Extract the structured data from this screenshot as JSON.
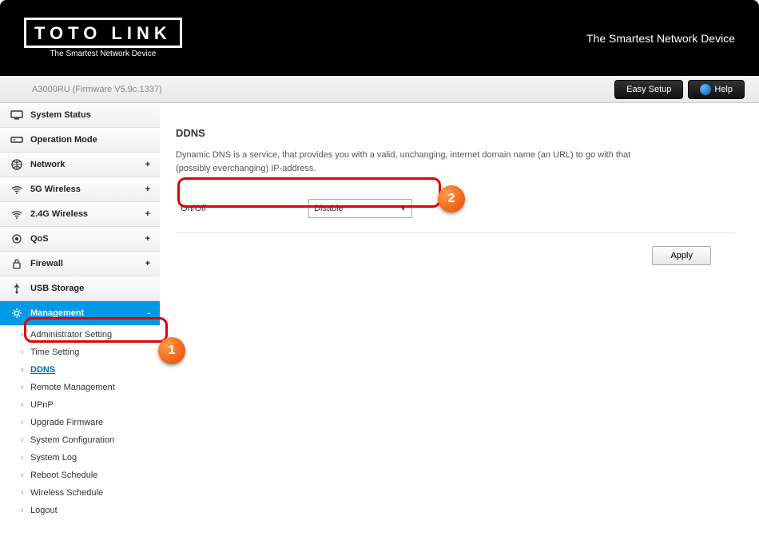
{
  "header": {
    "logo_top": "TOTO LINK",
    "logo_bottom": "The Smartest Network Device",
    "tagline": "The Smartest Network Device"
  },
  "topbar": {
    "device_info": "A3000RU (Firmware V5.9c.1337)",
    "easy_setup": "Easy Setup",
    "help": "Help"
  },
  "sidebar": {
    "items": [
      {
        "label": "System Status",
        "expandable": false
      },
      {
        "label": "Operation Mode",
        "expandable": false
      },
      {
        "label": "Network",
        "expandable": true
      },
      {
        "label": "5G Wireless",
        "expandable": true
      },
      {
        "label": "2.4G Wireless",
        "expandable": true
      },
      {
        "label": "QoS",
        "expandable": true
      },
      {
        "label": "Firewall",
        "expandable": true
      },
      {
        "label": "USB Storage",
        "expandable": false
      },
      {
        "label": "Management",
        "expandable": true,
        "active": true,
        "expand_char": "-"
      }
    ],
    "management_sub": [
      {
        "label": "Administrator Setting"
      },
      {
        "label": "Time Setting"
      },
      {
        "label": "DDNS",
        "selected": true
      },
      {
        "label": "Remote Management"
      },
      {
        "label": "UPnP"
      },
      {
        "label": "Upgrade Firmware"
      },
      {
        "label": "System Configuration"
      },
      {
        "label": "System Log"
      },
      {
        "label": "Reboot Schedule"
      },
      {
        "label": "Wireless Schedule"
      },
      {
        "label": "Logout"
      }
    ]
  },
  "main": {
    "title": "DDNS",
    "description": "Dynamic DNS is a service, that provides you with a valid, unchanging, internet domain name (an URL) to go with that (possibly everchanging) IP-address.",
    "onoff_label": "On/Off",
    "onoff_value": "Disable",
    "apply": "Apply"
  },
  "annotations": {
    "badge1": "1",
    "badge2": "2"
  }
}
